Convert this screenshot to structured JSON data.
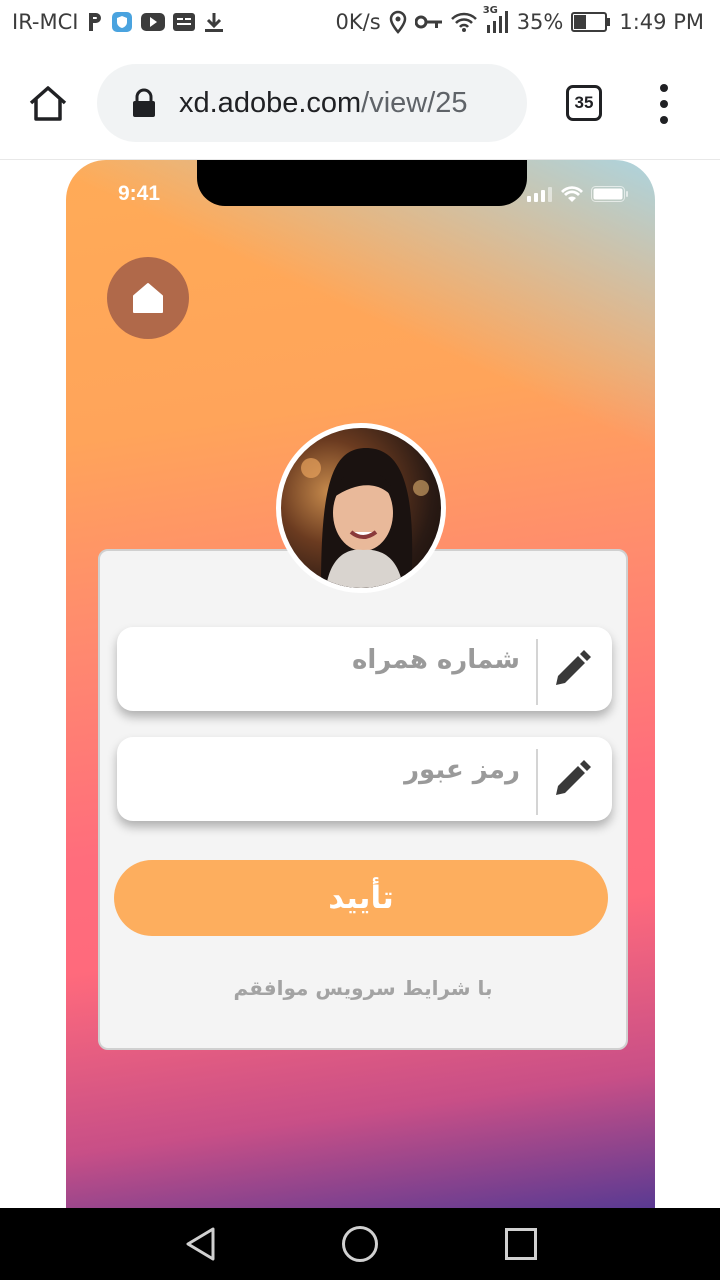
{
  "status_bar": {
    "carrier": "IR-MCI",
    "speed": "0K/s",
    "network": "3G",
    "battery": "35%",
    "time": "1:49 PM"
  },
  "browser": {
    "url_host": "xd.adobe.com",
    "url_path": "/view/25",
    "tab_count": "35"
  },
  "app": {
    "ios_time": "9:41",
    "phone_placeholder": "شماره همراه",
    "password_placeholder": "رمز عبور",
    "confirm_label": "تأیید",
    "terms_text": "با شرایط سرویس موافقم"
  },
  "colors": {
    "button": "#fdae5e",
    "home_circle": "#b0694a",
    "card": "#f4f4f4"
  }
}
